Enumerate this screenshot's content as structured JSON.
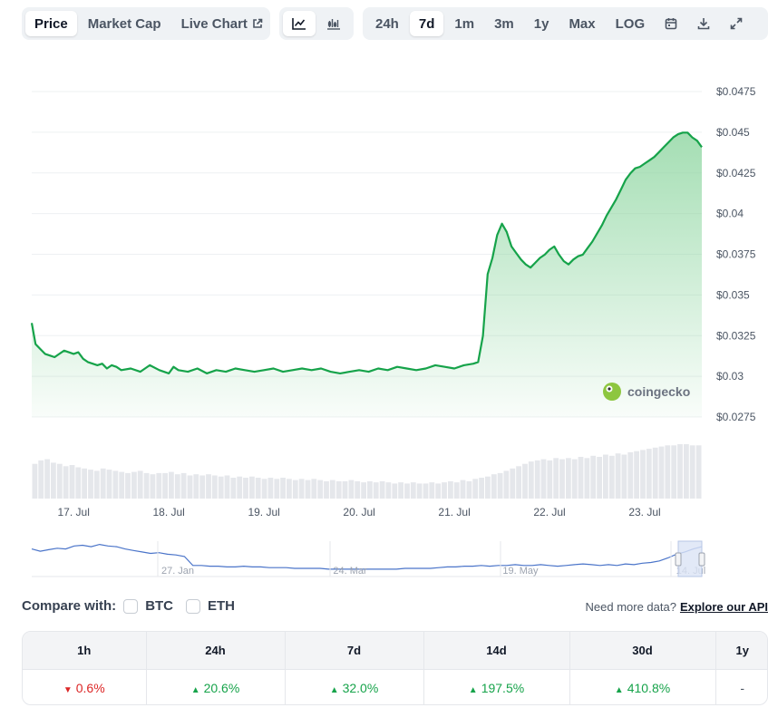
{
  "toolbar": {
    "view_tabs": [
      {
        "label": "Price",
        "active": true
      },
      {
        "label": "Market Cap",
        "active": false
      },
      {
        "label": "Live Chart",
        "active": false,
        "icon": "external-link-icon"
      }
    ],
    "chart_type_buttons": [
      {
        "icon": "line-chart-icon",
        "active": true
      },
      {
        "icon": "candlestick-icon",
        "active": false
      }
    ],
    "ranges": [
      {
        "label": "24h",
        "active": false
      },
      {
        "label": "7d",
        "active": true
      },
      {
        "label": "1m",
        "active": false
      },
      {
        "label": "3m",
        "active": false
      },
      {
        "label": "1y",
        "active": false
      },
      {
        "label": "Max",
        "active": false
      },
      {
        "label": "LOG",
        "active": false
      }
    ],
    "tool_icons": [
      "calendar-icon",
      "download-icon",
      "expand-icon"
    ]
  },
  "watermark": "coingecko",
  "colors": {
    "line": "#16a34a",
    "fill_top": "#86d39a",
    "volume": "#e5e7eb",
    "navigator_line": "#4a74c9",
    "navigator_select": "#dbe4f5",
    "up": "#16a34a",
    "down": "#dc2626",
    "grid": "#eef0f2"
  },
  "chart_data": {
    "type": "area",
    "y_ticks": [
      "$0.0475",
      "$0.045",
      "$0.0425",
      "$0.04",
      "$0.0375",
      "$0.035",
      "$0.0325",
      "$0.03",
      "$0.0275"
    ],
    "y_tick_values": [
      0.0475,
      0.045,
      0.0425,
      0.04,
      0.0375,
      0.035,
      0.0325,
      0.03,
      0.0275
    ],
    "ylim": [
      0.0275,
      0.0475
    ],
    "x_ticks": [
      {
        "label": "17. Jul",
        "day": 1
      },
      {
        "label": "18. Jul",
        "day": 2
      },
      {
        "label": "19. Jul",
        "day": 3
      },
      {
        "label": "20. Jul",
        "day": 4
      },
      {
        "label": "21. Jul",
        "day": 5
      },
      {
        "label": "22. Jul",
        "day": 6
      },
      {
        "label": "23. Jul",
        "day": 7
      }
    ],
    "xlim": [
      0.56,
      7.6
    ],
    "series": [
      {
        "points": [
          [
            0.56,
            0.033
          ],
          [
            0.6,
            0.0317
          ],
          [
            0.65,
            0.0314
          ],
          [
            0.7,
            0.0311
          ],
          [
            0.75,
            0.031
          ],
          [
            0.8,
            0.0309
          ],
          [
            0.85,
            0.0311
          ],
          [
            0.9,
            0.0313
          ],
          [
            0.95,
            0.0312
          ],
          [
            1.0,
            0.0311
          ],
          [
            1.05,
            0.0312
          ],
          [
            1.1,
            0.0308
          ],
          [
            1.15,
            0.0306
          ],
          [
            1.2,
            0.0305
          ],
          [
            1.25,
            0.0304
          ],
          [
            1.3,
            0.0305
          ],
          [
            1.35,
            0.0302
          ],
          [
            1.4,
            0.0304
          ],
          [
            1.45,
            0.0303
          ],
          [
            1.5,
            0.0301
          ],
          [
            1.6,
            0.0302
          ],
          [
            1.7,
            0.03
          ],
          [
            1.8,
            0.0304
          ],
          [
            1.9,
            0.0301
          ],
          [
            2.0,
            0.0299
          ],
          [
            2.05,
            0.0303
          ],
          [
            2.1,
            0.0301
          ],
          [
            2.2,
            0.03
          ],
          [
            2.3,
            0.0302
          ],
          [
            2.4,
            0.0299
          ],
          [
            2.5,
            0.0301
          ],
          [
            2.6,
            0.03
          ],
          [
            2.7,
            0.0302
          ],
          [
            2.8,
            0.0301
          ],
          [
            2.9,
            0.03
          ],
          [
            3.0,
            0.0301
          ],
          [
            3.1,
            0.0302
          ],
          [
            3.2,
            0.03
          ],
          [
            3.3,
            0.0301
          ],
          [
            3.4,
            0.0302
          ],
          [
            3.5,
            0.0301
          ],
          [
            3.6,
            0.0302
          ],
          [
            3.7,
            0.03
          ],
          [
            3.8,
            0.0299
          ],
          [
            3.9,
            0.03
          ],
          [
            4.0,
            0.0301
          ],
          [
            4.1,
            0.03
          ],
          [
            4.2,
            0.0302
          ],
          [
            4.3,
            0.0301
          ],
          [
            4.4,
            0.0303
          ],
          [
            4.5,
            0.0302
          ],
          [
            4.6,
            0.0301
          ],
          [
            4.7,
            0.0302
          ],
          [
            4.8,
            0.0304
          ],
          [
            4.9,
            0.0303
          ],
          [
            5.0,
            0.0302
          ],
          [
            5.1,
            0.0304
          ],
          [
            5.2,
            0.0305
          ],
          [
            5.25,
            0.0306
          ],
          [
            5.3,
            0.0322
          ],
          [
            5.35,
            0.036
          ],
          [
            5.4,
            0.037
          ],
          [
            5.45,
            0.0384
          ],
          [
            5.5,
            0.0391
          ],
          [
            5.55,
            0.0386
          ],
          [
            5.6,
            0.0377
          ],
          [
            5.65,
            0.0373
          ],
          [
            5.7,
            0.0369
          ],
          [
            5.75,
            0.0366
          ],
          [
            5.8,
            0.0364
          ],
          [
            5.85,
            0.0367
          ],
          [
            5.9,
            0.037
          ],
          [
            5.95,
            0.0372
          ],
          [
            6.0,
            0.0375
          ],
          [
            6.05,
            0.0377
          ],
          [
            6.1,
            0.0372
          ],
          [
            6.15,
            0.0368
          ],
          [
            6.2,
            0.0366
          ],
          [
            6.25,
            0.0369
          ],
          [
            6.3,
            0.0371
          ],
          [
            6.35,
            0.0372
          ],
          [
            6.4,
            0.0376
          ],
          [
            6.45,
            0.038
          ],
          [
            6.5,
            0.0385
          ],
          [
            6.55,
            0.039
          ],
          [
            6.6,
            0.0396
          ],
          [
            6.65,
            0.0401
          ],
          [
            6.7,
            0.0406
          ],
          [
            6.75,
            0.0412
          ],
          [
            6.8,
            0.0418
          ],
          [
            6.85,
            0.0422
          ],
          [
            6.9,
            0.0425
          ],
          [
            6.95,
            0.0426
          ],
          [
            7.0,
            0.0428
          ],
          [
            7.05,
            0.043
          ],
          [
            7.1,
            0.0432
          ],
          [
            7.15,
            0.0435
          ],
          [
            7.2,
            0.0438
          ],
          [
            7.25,
            0.0441
          ],
          [
            7.3,
            0.0444
          ],
          [
            7.35,
            0.0446
          ],
          [
            7.4,
            0.0447
          ],
          [
            7.45,
            0.0447
          ],
          [
            7.5,
            0.0444
          ],
          [
            7.55,
            0.0442
          ],
          [
            7.6,
            0.0438
          ]
        ]
      }
    ],
    "volume": [
      30,
      33,
      34,
      31,
      30,
      28,
      29,
      27,
      26,
      25,
      24,
      26,
      25,
      24,
      23,
      22,
      23,
      24,
      22,
      21,
      22,
      22,
      23,
      21,
      22,
      20,
      21,
      20,
      21,
      20,
      19,
      20,
      18,
      19,
      18,
      19,
      18,
      17,
      18,
      17,
      18,
      17,
      16,
      17,
      16,
      17,
      16,
      15,
      16,
      15,
      15,
      16,
      15,
      14,
      15,
      14,
      15,
      14,
      13,
      14,
      13,
      14,
      13,
      13,
      14,
      13,
      14,
      15,
      14,
      16,
      15,
      17,
      18,
      19,
      21,
      22,
      24,
      26,
      28,
      30,
      32,
      33,
      34,
      33,
      35,
      34,
      35,
      34,
      36,
      35,
      37,
      36,
      38,
      37,
      39,
      38,
      40,
      41,
      42,
      43,
      44,
      45,
      46,
      46,
      47,
      47,
      46,
      46
    ],
    "navigator": {
      "x_ticks": [
        "27. Jan",
        "24. Mar",
        "19. May",
        "14. Jul"
      ],
      "values": [
        0.052,
        0.049,
        0.051,
        0.053,
        0.052,
        0.056,
        0.057,
        0.055,
        0.058,
        0.056,
        0.055,
        0.052,
        0.05,
        0.048,
        0.046,
        0.047,
        0.045,
        0.044,
        0.042,
        0.03,
        0.03,
        0.029,
        0.029,
        0.028,
        0.028,
        0.029,
        0.028,
        0.028,
        0.027,
        0.027,
        0.027,
        0.026,
        0.026,
        0.026,
        0.026,
        0.025,
        0.025,
        0.025,
        0.025,
        0.025,
        0.025,
        0.025,
        0.025,
        0.025,
        0.026,
        0.026,
        0.026,
        0.026,
        0.027,
        0.028,
        0.028,
        0.029,
        0.029,
        0.03,
        0.029,
        0.03,
        0.03,
        0.031,
        0.03,
        0.03,
        0.031,
        0.03,
        0.029,
        0.03,
        0.031,
        0.032,
        0.031,
        0.03,
        0.031,
        0.03,
        0.032,
        0.031,
        0.033,
        0.034,
        0.036,
        0.04,
        0.045,
        0.048,
        0.052,
        0.055
      ]
    }
  },
  "compare": {
    "label": "Compare with:",
    "options": [
      "BTC",
      "ETH"
    ]
  },
  "more_data": {
    "text": "Need more data?",
    "link": "Explore our API"
  },
  "performance": {
    "headers": [
      "1h",
      "24h",
      "7d",
      "14d",
      "30d",
      "1y"
    ],
    "values": [
      {
        "text": "0.6%",
        "dir": "down"
      },
      {
        "text": "20.6%",
        "dir": "up"
      },
      {
        "text": "32.0%",
        "dir": "up"
      },
      {
        "text": "197.5%",
        "dir": "up"
      },
      {
        "text": "410.8%",
        "dir": "up"
      },
      {
        "text": "-",
        "dir": "none"
      }
    ]
  }
}
